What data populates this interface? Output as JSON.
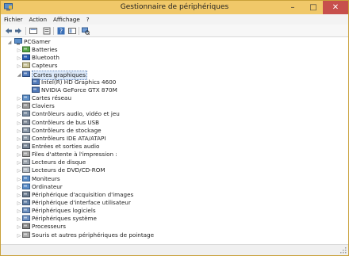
{
  "window": {
    "title": "Gestionnaire de périphériques",
    "controls": {
      "minimize": "–",
      "maximize": "□",
      "close": "✕"
    }
  },
  "menu": [
    "Fichier",
    "Action",
    "Affichage",
    "?"
  ],
  "toolbar": [
    "back-arrow-icon",
    "forward-arrow-icon",
    "properties-icon",
    "show-hide-icon",
    "help-icon",
    "update-driver-icon",
    "scan-hardware-icon"
  ],
  "tree": {
    "root": "PCGamer",
    "items": [
      {
        "label": "Batteries",
        "icon": "battery-icon"
      },
      {
        "label": "Bluetooth",
        "icon": "bluetooth-icon"
      },
      {
        "label": "Capteurs",
        "icon": "sensor-icon"
      },
      {
        "label": "Cartes graphiques",
        "icon": "display-adapter-icon",
        "expanded": true,
        "selected": true,
        "children": [
          "Intel(R) HD Graphics 4600",
          "NVIDIA GeForce GTX 870M"
        ]
      },
      {
        "label": "Cartes réseau",
        "icon": "network-adapter-icon"
      },
      {
        "label": "Claviers",
        "icon": "keyboard-icon"
      },
      {
        "label": "Contrôleurs audio, vidéo et jeu",
        "icon": "audio-icon"
      },
      {
        "label": "Contrôleurs de bus USB",
        "icon": "usb-icon"
      },
      {
        "label": "Contrôleurs de stockage",
        "icon": "storage-icon"
      },
      {
        "label": "Contrôleurs IDE ATA/ATAPI",
        "icon": "ide-icon"
      },
      {
        "label": "Entrées et sorties audio",
        "icon": "speaker-icon"
      },
      {
        "label": "Files d'attente à l'impression :",
        "icon": "printer-queue-icon"
      },
      {
        "label": "Lecteurs de disque",
        "icon": "disk-drive-icon"
      },
      {
        "label": "Lecteurs de DVD/CD-ROM",
        "icon": "dvd-icon"
      },
      {
        "label": "Moniteurs",
        "icon": "monitor-icon"
      },
      {
        "label": "Ordinateur",
        "icon": "computer-icon"
      },
      {
        "label": "Périphérique d'acquisition d'images",
        "icon": "camera-icon"
      },
      {
        "label": "Périphérique d'interface utilisateur",
        "icon": "hid-icon"
      },
      {
        "label": "Périphériques logiciels",
        "icon": "software-device-icon"
      },
      {
        "label": "Périphériques système",
        "icon": "system-device-icon"
      },
      {
        "label": "Processeurs",
        "icon": "processor-icon"
      },
      {
        "label": "Souris et autres périphériques de pointage",
        "icon": "mouse-icon"
      }
    ]
  },
  "colors": {
    "titlebar": "#f0c869",
    "close": "#c7504c",
    "selection": "#dbe8f8"
  }
}
